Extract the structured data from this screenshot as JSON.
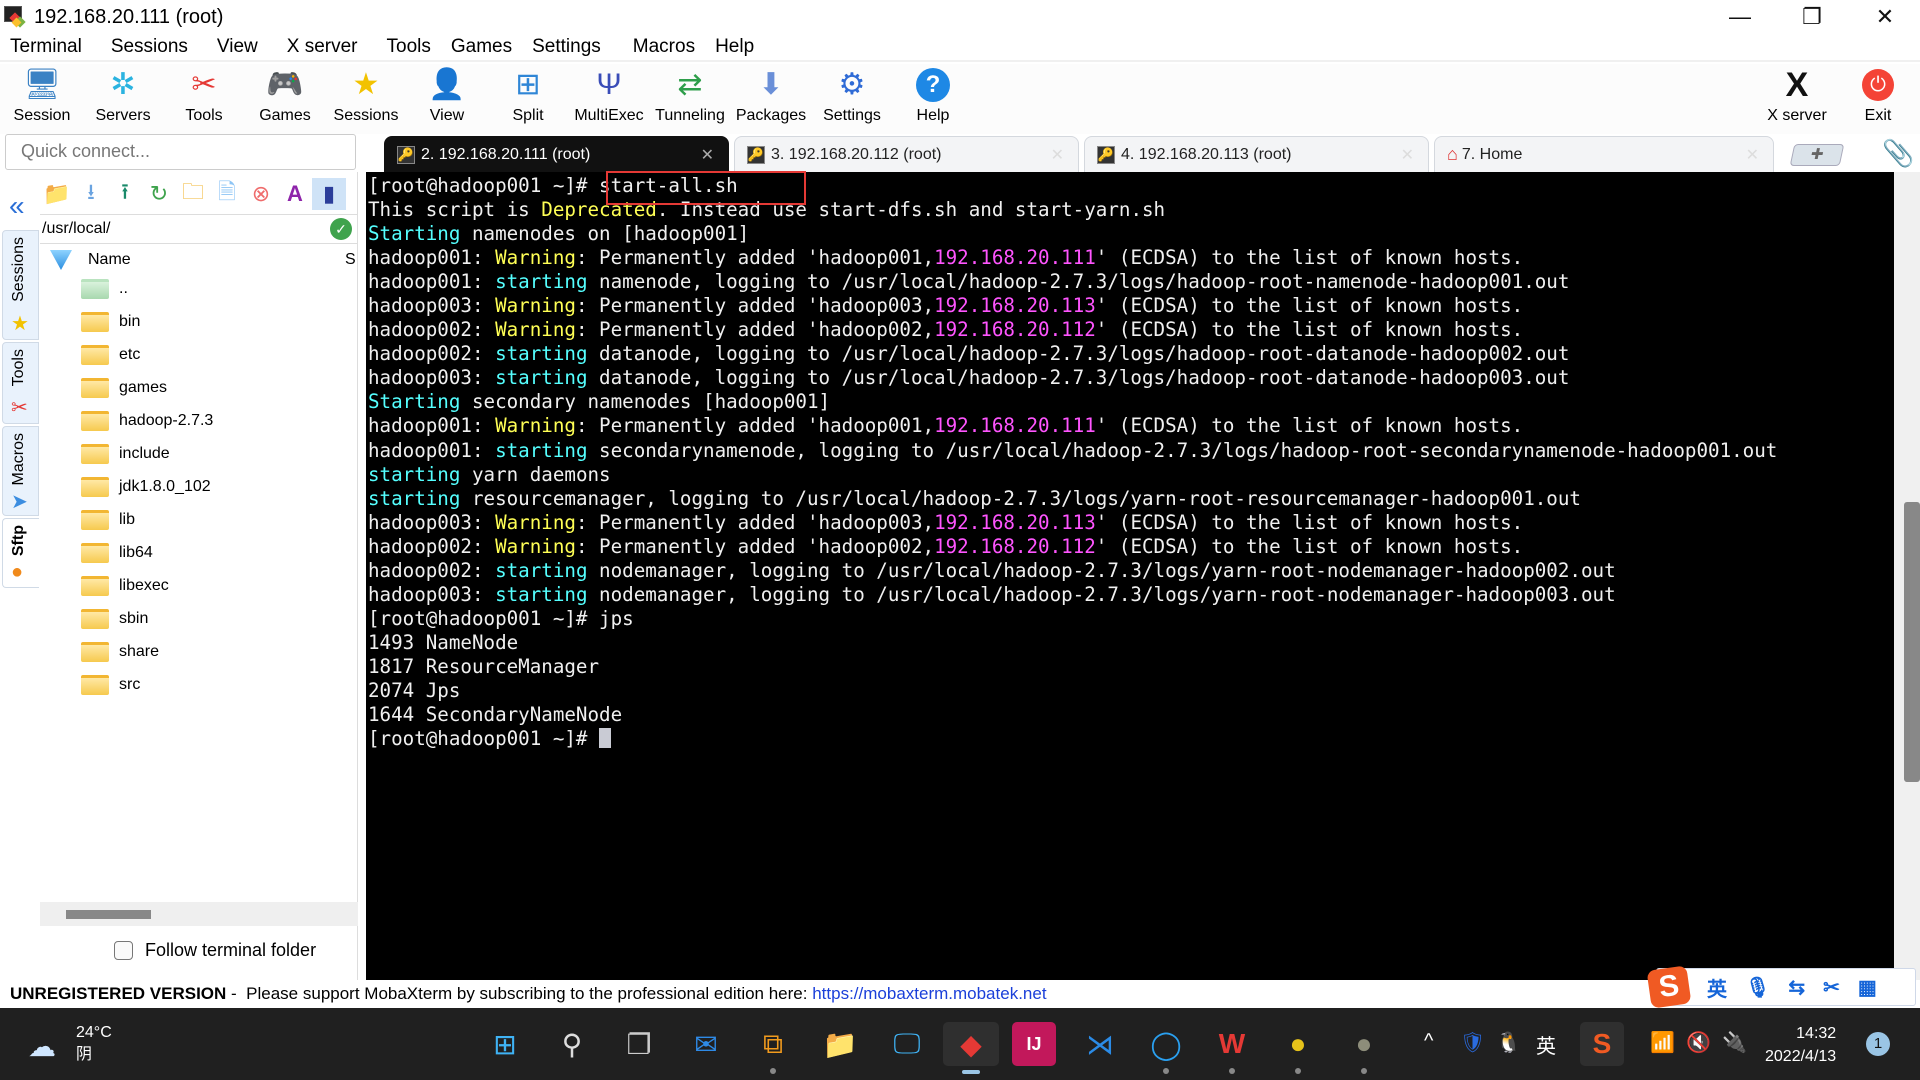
{
  "window": {
    "title": "192.168.20.111 (root)",
    "controls": {
      "minimize": "—",
      "restore": "❐",
      "close": "✕"
    }
  },
  "menu": [
    "Terminal",
    "Sessions",
    "View",
    "X server",
    "Tools",
    "Games",
    "Settings",
    "Macros",
    "Help"
  ],
  "toolbar": {
    "buttons": [
      {
        "label": "Session",
        "icon": "session-icon"
      },
      {
        "label": "Servers",
        "icon": "servers-icon"
      },
      {
        "label": "Tools",
        "icon": "tools-icon"
      },
      {
        "label": "Games",
        "icon": "games-icon"
      },
      {
        "label": "Sessions",
        "icon": "star-icon"
      },
      {
        "label": "View",
        "icon": "view-icon"
      },
      {
        "label": "Split",
        "icon": "split-icon"
      },
      {
        "label": "MultiExec",
        "icon": "multiexec-icon"
      },
      {
        "label": "Tunneling",
        "icon": "tunneling-icon"
      },
      {
        "label": "Packages",
        "icon": "packages-icon"
      },
      {
        "label": "Settings",
        "icon": "settings-icon"
      },
      {
        "label": "Help",
        "icon": "help-icon"
      }
    ],
    "right_buttons": [
      {
        "label": "X server",
        "icon": "xserver-icon"
      },
      {
        "label": "Exit",
        "icon": "power-icon"
      }
    ]
  },
  "quick_connect": {
    "placeholder": "Quick connect..."
  },
  "tabs": [
    {
      "label": "2. 192.168.20.111 (root)",
      "active": true
    },
    {
      "label": "3. 192.168.20.112 (root)",
      "active": false
    },
    {
      "label": "4. 192.168.20.113 (root)",
      "active": false
    },
    {
      "label": "7. Home",
      "active": false
    }
  ],
  "side_tabs": [
    "Sessions",
    "Tools",
    "Macros",
    "Sftp"
  ],
  "sftp": {
    "path": "/usr/local/",
    "columns": {
      "name": "Name",
      "size": "S"
    },
    "files": [
      "..",
      "bin",
      "etc",
      "games",
      "hadoop-2.7.3",
      "include",
      "jdk1.8.0_102",
      "lib",
      "lib64",
      "libexec",
      "sbin",
      "share",
      "src"
    ],
    "follow_label": "Follow terminal folder",
    "follow_checked": false
  },
  "terminal": {
    "prompt": "[root@hadoop001 ~]# ",
    "lines": [
      [
        {
          "t": "[root@hadoop001 ~]# "
        },
        {
          "t": "start-all.sh"
        }
      ],
      [
        {
          "t": "This script is "
        },
        {
          "t": "Deprecated",
          "c": "y"
        },
        {
          "t": ". Instead use start-dfs.sh and start-yarn.sh"
        }
      ],
      [
        {
          "t": "Starting",
          "c": "c"
        },
        {
          "t": " namenodes on [hadoop001]"
        }
      ],
      [
        {
          "t": "hadoop001: "
        },
        {
          "t": "Warning",
          "c": "y"
        },
        {
          "t": ": Permanently added 'hadoop001,"
        },
        {
          "t": "192.168.20.111",
          "c": "m"
        },
        {
          "t": "' (ECDSA) to the list of known hosts."
        }
      ],
      [
        {
          "t": "hadoop001: "
        },
        {
          "t": "starting",
          "c": "c"
        },
        {
          "t": " namenode, logging to /usr/local/hadoop-2.7.3/logs/hadoop-root-namenode-hadoop001.out"
        }
      ],
      [
        {
          "t": "hadoop003: "
        },
        {
          "t": "Warning",
          "c": "y"
        },
        {
          "t": ": Permanently added 'hadoop003,"
        },
        {
          "t": "192.168.20.113",
          "c": "m"
        },
        {
          "t": "' (ECDSA) to the list of known hosts."
        }
      ],
      [
        {
          "t": "hadoop002: "
        },
        {
          "t": "Warning",
          "c": "y"
        },
        {
          "t": ": Permanently added 'hadoop002,"
        },
        {
          "t": "192.168.20.112",
          "c": "m"
        },
        {
          "t": "' (ECDSA) to the list of known hosts."
        }
      ],
      [
        {
          "t": "hadoop002: "
        },
        {
          "t": "starting",
          "c": "c"
        },
        {
          "t": " datanode, logging to /usr/local/hadoop-2.7.3/logs/hadoop-root-datanode-hadoop002.out"
        }
      ],
      [
        {
          "t": "hadoop003: "
        },
        {
          "t": "starting",
          "c": "c"
        },
        {
          "t": " datanode, logging to /usr/local/hadoop-2.7.3/logs/hadoop-root-datanode-hadoop003.out"
        }
      ],
      [
        {
          "t": "Starting",
          "c": "c"
        },
        {
          "t": " secondary namenodes [hadoop001]"
        }
      ],
      [
        {
          "t": "hadoop001: "
        },
        {
          "t": "Warning",
          "c": "y"
        },
        {
          "t": ": Permanently added 'hadoop001,"
        },
        {
          "t": "192.168.20.111",
          "c": "m"
        },
        {
          "t": "' (ECDSA) to the list of known hosts."
        }
      ],
      [
        {
          "t": "hadoop001: "
        },
        {
          "t": "starting",
          "c": "c"
        },
        {
          "t": " secondarynamenode, logging to /usr/local/hadoop-2.7.3/logs/hadoop-root-secondarynamenode-hadoop001.out"
        }
      ],
      [
        {
          "t": "starting",
          "c": "c"
        },
        {
          "t": " yarn daemons"
        }
      ],
      [
        {
          "t": "starting",
          "c": "c"
        },
        {
          "t": " resourcemanager, logging to /usr/local/hadoop-2.7.3/logs/yarn-root-resourcemanager-hadoop001.out"
        }
      ],
      [
        {
          "t": "hadoop003: "
        },
        {
          "t": "Warning",
          "c": "y"
        },
        {
          "t": ": Permanently added 'hadoop003,"
        },
        {
          "t": "192.168.20.113",
          "c": "m"
        },
        {
          "t": "' (ECDSA) to the list of known hosts."
        }
      ],
      [
        {
          "t": "hadoop002: "
        },
        {
          "t": "Warning",
          "c": "y"
        },
        {
          "t": ": Permanently added 'hadoop002,"
        },
        {
          "t": "192.168.20.112",
          "c": "m"
        },
        {
          "t": "' (ECDSA) to the list of known hosts."
        }
      ],
      [
        {
          "t": "hadoop002: "
        },
        {
          "t": "starting",
          "c": "c"
        },
        {
          "t": " nodemanager, logging to /usr/local/hadoop-2.7.3/logs/yarn-root-nodemanager-hadoop002.out"
        }
      ],
      [
        {
          "t": "hadoop003: "
        },
        {
          "t": "starting",
          "c": "c"
        },
        {
          "t": " nodemanager, logging to /usr/local/hadoop-2.7.3/logs/yarn-root-nodemanager-hadoop003.out"
        }
      ],
      [
        {
          "t": "[root@hadoop001 ~]# jps"
        }
      ],
      [
        {
          "t": "1493 NameNode"
        }
      ],
      [
        {
          "t": "1817 ResourceManager"
        }
      ],
      [
        {
          "t": "2074 Jps"
        }
      ],
      [
        {
          "t": "1644 SecondaryNameNode"
        }
      ],
      [
        {
          "t": "[root@hadoop001 ~]# "
        },
        {
          "cursor": true
        }
      ]
    ],
    "colors": {
      "y": "#ffff55",
      "c": "#55ffff",
      "m": "#ff55ff",
      "highlight_box": "#e53935"
    }
  },
  "statusbar": {
    "unregistered": "UNREGISTERED VERSION",
    "sep": " - ",
    "message": "Please support MobaXterm by subscribing to the professional edition here:",
    "link": "https://mobaxterm.mobatek.net"
  },
  "ime_bar": {
    "logo": "S",
    "lang": "英",
    "icons": [
      "mic-icon",
      "translate-icon",
      "scissors-icon",
      "grid-icon"
    ]
  },
  "taskbar": {
    "weather": {
      "temp": "24°C",
      "condition": "阴"
    },
    "apps": [
      "start",
      "search",
      "task-view",
      "mail",
      "teams",
      "explorer",
      "remote-desktop",
      "mobaxterm",
      "intellij",
      "vscode",
      "qq-browser",
      "wps",
      "ultraedit",
      "dog-avatar-app"
    ],
    "tray": {
      "ime": "英",
      "time": "14:32",
      "date": "2022/4/13",
      "notifications": "1"
    }
  }
}
